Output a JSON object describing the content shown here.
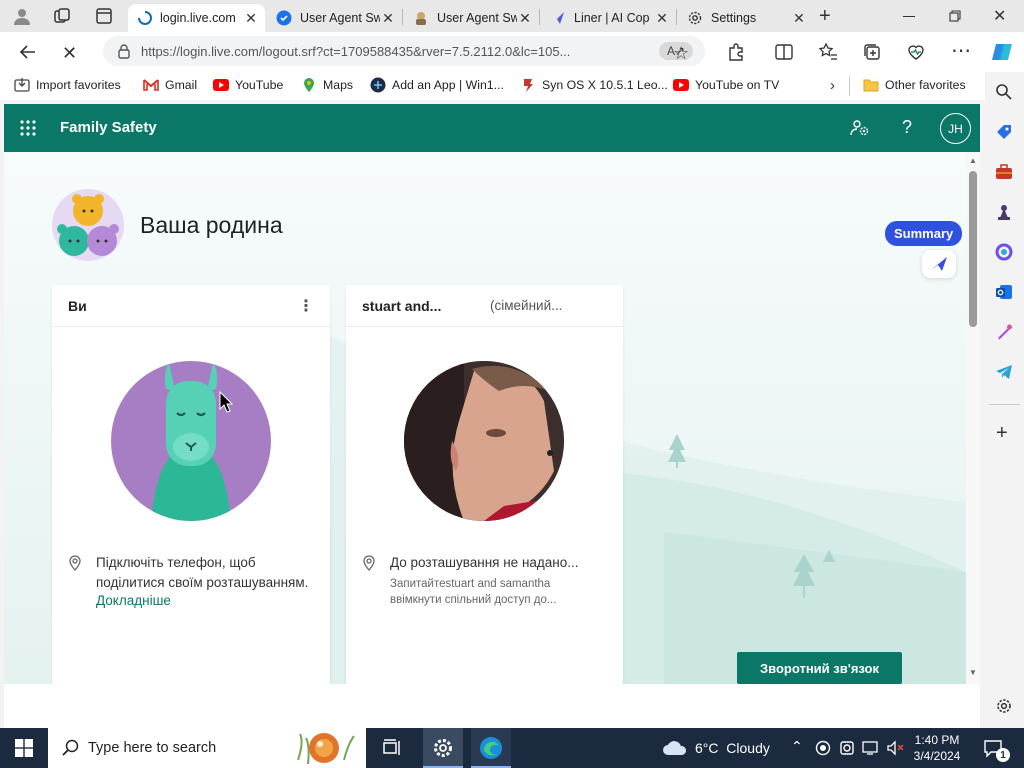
{
  "browser": {
    "tabs": [
      {
        "label": "login.live.com",
        "icon": "loading-icon",
        "active": true
      },
      {
        "label": "User Agent Sw",
        "icon": "extension-icon",
        "active": false
      },
      {
        "label": "User Agent Sw",
        "icon": "extension-icon",
        "active": false
      },
      {
        "label": "Liner | AI Cop",
        "icon": "liner-icon",
        "active": false
      },
      {
        "label": "Settings",
        "icon": "gear-icon",
        "active": false
      }
    ],
    "url": "https://login.live.com/logout.srf?ct=1709588435&rver=7.5.2112.0&lc=105...",
    "favorites": [
      {
        "label": "Import favorites",
        "icon": "import-icon"
      },
      {
        "label": "Gmail",
        "icon": "gmail-icon"
      },
      {
        "label": "YouTube",
        "icon": "youtube-icon"
      },
      {
        "label": "Maps",
        "icon": "maps-icon"
      },
      {
        "label": "Add an App | Win1...",
        "icon": "app-icon"
      },
      {
        "label": "Syn OS X 10.5.1 Leo...",
        "icon": "syn-icon"
      },
      {
        "label": "YouTube on TV",
        "icon": "youtube-icon"
      }
    ],
    "other_favorites": "Other favorites"
  },
  "app": {
    "title": "Family Safety",
    "user_initials": "JH",
    "heading": "Ваша родина",
    "summary_label": "Summary",
    "feedback_button": "Зворотний зв'язок",
    "accent": "#0b7767"
  },
  "cards": [
    {
      "name": "Ви",
      "role": "",
      "location_title": "Підключіть телефон, щоб поділитися своїм розташуванням.",
      "link": "Докладніше",
      "location_sub": ""
    },
    {
      "name": "stuart and...",
      "role": "(сімейний...",
      "location_title": "До розташування не надано...",
      "link": "",
      "location_sub": "Запитайтеstuart and samantha ввімкнути спільний доступ до..."
    }
  ],
  "taskbar": {
    "search_placeholder": "Type here to search",
    "weather": "6°C  Cloudy",
    "time": "1:40 PM",
    "date": "3/4/2024",
    "notification_count": "1"
  }
}
